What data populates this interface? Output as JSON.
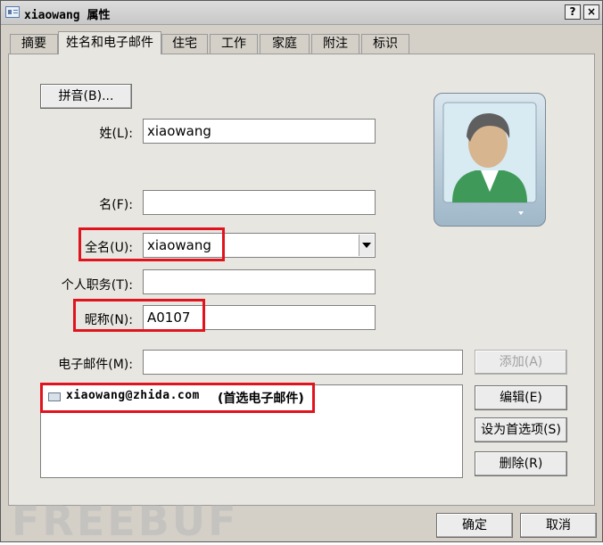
{
  "window": {
    "title": "xiaowang 属性",
    "help_label": "?",
    "close_label": "×"
  },
  "tabs": [
    "摘要",
    "姓名和电子邮件",
    "住宅",
    "工作",
    "家庭",
    "附注",
    "标识"
  ],
  "active_tab_index": 1,
  "form": {
    "phonetic_button": "拼音(B)...",
    "last_name_label": "姓(L):",
    "last_name_value": "xiaowang",
    "first_name_label": "名(F):",
    "first_name_value": "",
    "full_name_label": "全名(U):",
    "full_name_value": "xiaowang",
    "job_title_label": "个人职务(T):",
    "job_title_value": "",
    "nickname_label": "昵称(N):",
    "nickname_value": "A0107",
    "email_label": "电子邮件(M):",
    "email_value": "",
    "add_button": "添加(A)",
    "edit_button": "编辑(E)",
    "set_default_button": "设为首选项(S)",
    "delete_button": "删除(R)"
  },
  "email_list": [
    {
      "address": "xiaowang@zhida.com",
      "note": "(首选电子邮件)",
      "icon": "mail-icon"
    }
  ],
  "footer": {
    "ok_button": "确定",
    "cancel_button": "取消"
  },
  "watermark": "FREEBUF",
  "colors": {
    "highlight": "#e0141e",
    "dialog_bg": "#d4d0c8"
  }
}
